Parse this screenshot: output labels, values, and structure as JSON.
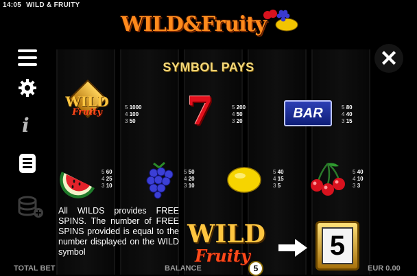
{
  "status_bar": {
    "time": "14:05",
    "title": "WILD & FRUITY"
  },
  "logo": {
    "text": "WILD&Fruity",
    "faded_subtitle": ""
  },
  "side_menu": [
    {
      "icon": "hamburger-menu-icon"
    },
    {
      "icon": "gear-icon"
    },
    {
      "icon": "info-icon",
      "glyph": "i"
    },
    {
      "icon": "paytable-icon"
    },
    {
      "icon": "coin-stack-icon"
    }
  ],
  "close_label": "✕",
  "paytable": {
    "heading": "SYMBOL PAYS",
    "symbols": [
      {
        "name": "wild",
        "label_top": "WILD",
        "label_bottom": "Fruity",
        "pays": [
          [
            "5",
            "1000"
          ],
          [
            "4",
            "100"
          ],
          [
            "3",
            "50"
          ]
        ]
      },
      {
        "name": "seven",
        "glyph": "7",
        "pays": [
          [
            "5",
            "200"
          ],
          [
            "4",
            "50"
          ],
          [
            "3",
            "20"
          ]
        ]
      },
      {
        "name": "bar",
        "glyph": "BAR",
        "pays": [
          [
            "5",
            "80"
          ],
          [
            "4",
            "40"
          ],
          [
            "3",
            "15"
          ]
        ]
      },
      {
        "name": "watermelon",
        "pays": [
          [
            "5",
            "60"
          ],
          [
            "4",
            "25"
          ],
          [
            "3",
            "10"
          ]
        ]
      },
      {
        "name": "blackberry",
        "pays": [
          [
            "5",
            "50"
          ],
          [
            "4",
            "20"
          ],
          [
            "3",
            "10"
          ]
        ]
      },
      {
        "name": "lemon",
        "pays": [
          [
            "5",
            "40"
          ],
          [
            "4",
            "15"
          ],
          [
            "3",
            "5"
          ]
        ]
      },
      {
        "name": "cherries",
        "pays": [
          [
            "5",
            "40"
          ],
          [
            "4",
            "10"
          ],
          [
            "3",
            "3"
          ]
        ]
      }
    ],
    "description": "All WILDS provides FREE SPINS. The number of FREE SPINS provided is equal to the number displayed on the WILD symbol",
    "example_wild_number": "5",
    "example_result": "5"
  },
  "bottom_bar": {
    "total_bet": "TOTAL BET",
    "balance": "BALANCE",
    "amount": "EUR 0.00"
  },
  "colors": {
    "heading": "#f2d77a",
    "bar_blue": "#1f2fa0",
    "seven_red": "#e3101c",
    "wild_gold": "#ffc640"
  }
}
